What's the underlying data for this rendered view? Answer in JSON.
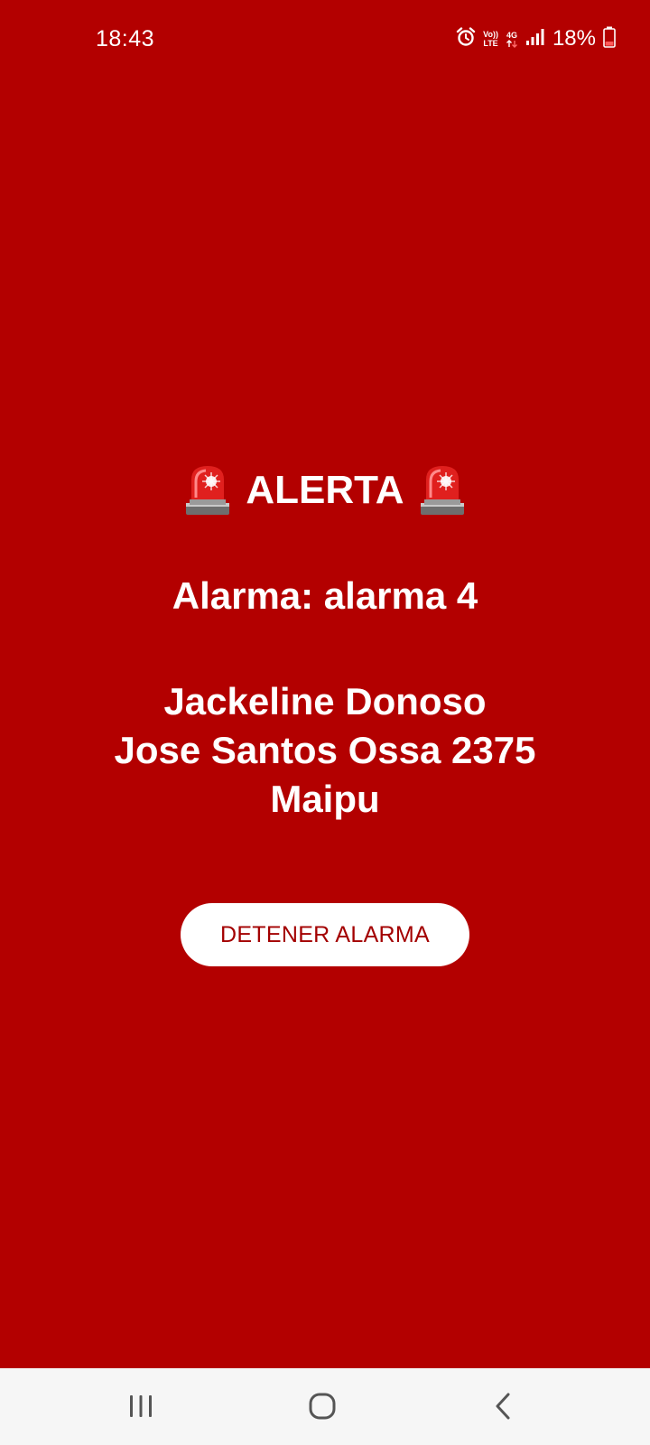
{
  "status_bar": {
    "time": "18:43",
    "icons": [
      "alarm-clock-icon",
      "volte-icon",
      "4g-data-icon",
      "signal-icon",
      "battery-icon"
    ],
    "volte_top": "Vo))",
    "volte_bottom": "LTE",
    "data_type": "4G",
    "battery_percent": "18%"
  },
  "alert": {
    "title": "ALERTA",
    "alarm_line": "Alarma: alarma 4",
    "name": "Jackeline Donoso",
    "address": "Jose Santos Ossa 2375",
    "commune": "Maipu",
    "stop_button_label": "DETENER ALARMA"
  },
  "nav_bar": {
    "icons": [
      "recent-apps-icon",
      "home-icon",
      "back-icon"
    ]
  },
  "colors": {
    "background": "#B30000",
    "text": "#FFFFFF",
    "button_bg": "#FFFFFF",
    "button_text": "#A30000",
    "nav_bg": "#F6F6F6"
  }
}
